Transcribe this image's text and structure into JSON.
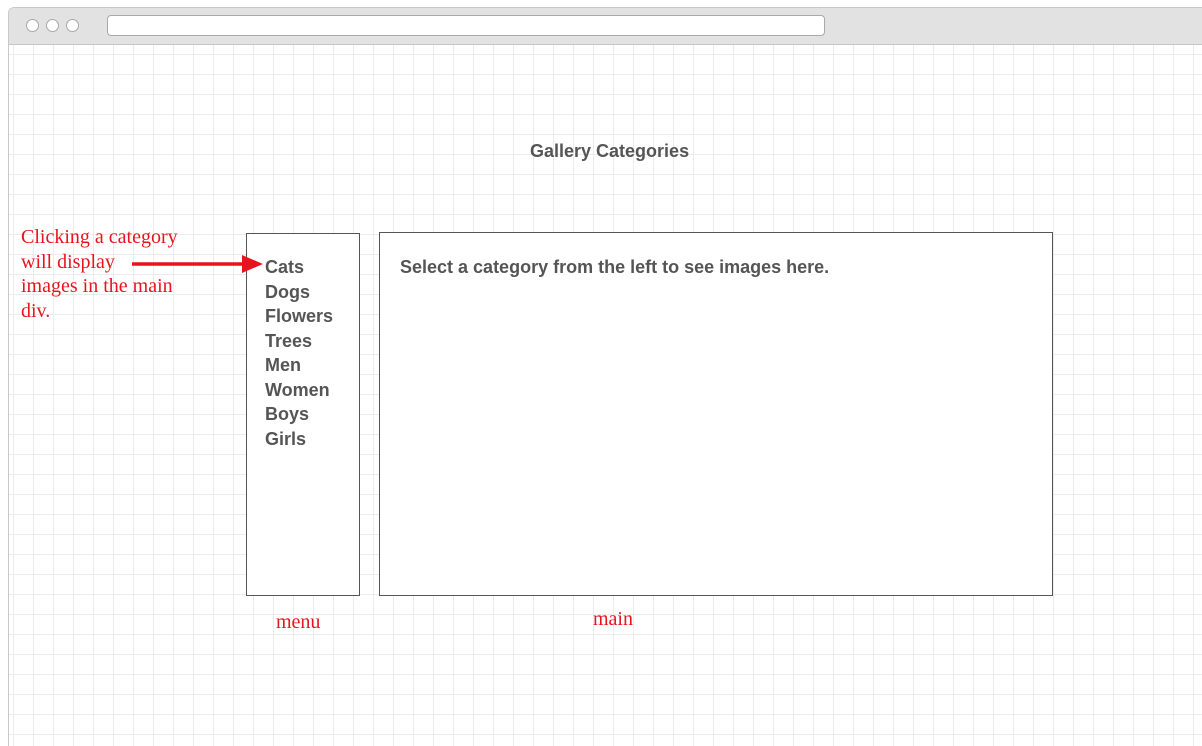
{
  "page": {
    "title": "Gallery Categories"
  },
  "menu": {
    "items": [
      "Cats",
      "Dogs",
      "Flowers",
      "Trees",
      "Men",
      "Women",
      "Boys",
      "Girls"
    ]
  },
  "main": {
    "placeholder_text": "Select a category from the left to see images here."
  },
  "annotations": {
    "note_lines": [
      "Clicking a category",
      "will display",
      "images in the main",
      "div."
    ],
    "menu_label": "menu",
    "main_label": "main",
    "color": "#e8141c"
  },
  "colors": {
    "text": "#555555",
    "grid": "#ececec",
    "titlebar": "#e2e2e2"
  },
  "icons": {
    "arrow": "right-arrow-icon"
  }
}
